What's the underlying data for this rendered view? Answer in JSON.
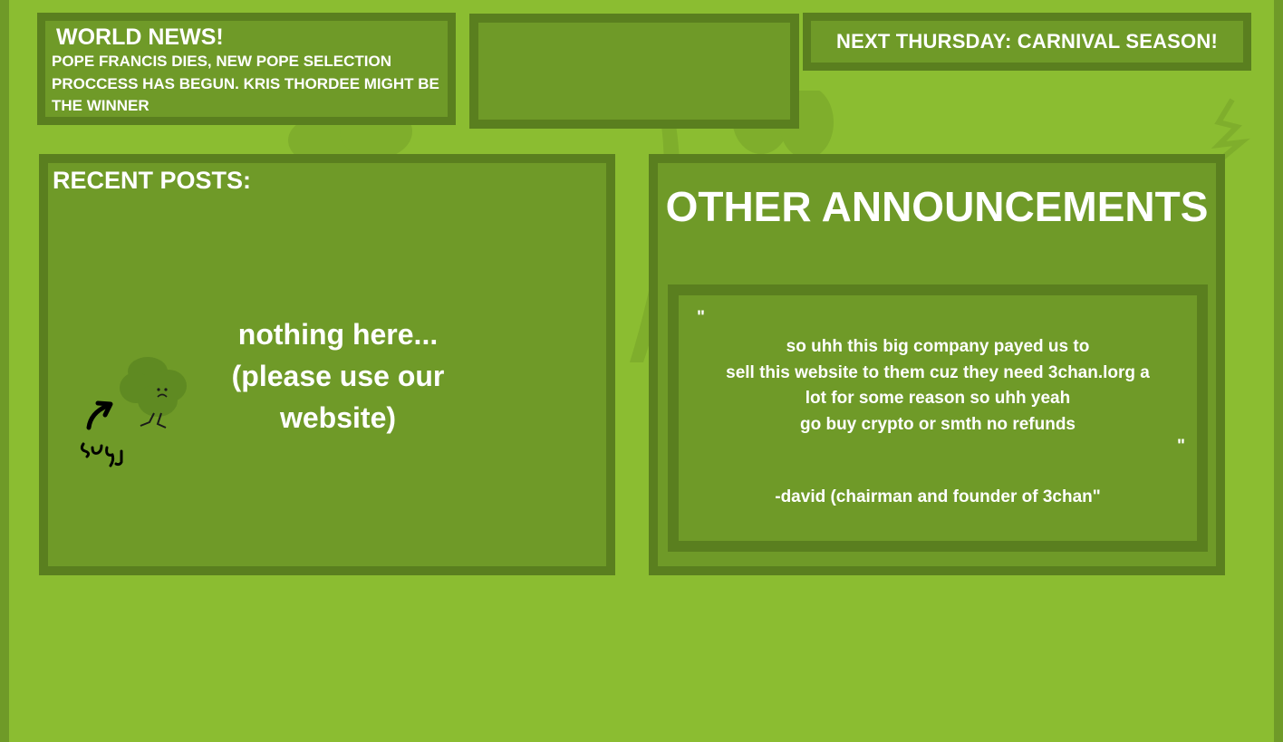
{
  "colors": {
    "background": "#8bbd31",
    "panel": "#6f9a28",
    "panel_border": "#5a7f1f",
    "text": "#ffffff"
  },
  "world_news": {
    "title": "WORLD NEWS!",
    "body": "POPE FRANCIS DIES, NEW POPE SELECTION PROCCESS HAS BEGUN. KRIS THORDEE MIGHT BE THE WINNER"
  },
  "event_banner": {
    "text": "NEXT THURSDAY: CARNIVAL SEASON!"
  },
  "recent_posts": {
    "title": "RECENT POSTS:",
    "empty_message": "nothing here... (please use our website)",
    "doodle_icon": "sad-clover-doodle-icon"
  },
  "announcements": {
    "title": "OTHER ANNOUNCEMENTS",
    "open_quote": "\"",
    "message": "so uhh this big company payed us to\nsell this website to them cuz they need 3chan.lorg a\nlot for some reason so uhh yeah\ngo buy crypto or smth no refunds",
    "close_quote": "\"",
    "signature": "-david (chairman and founder of 3chan\""
  }
}
